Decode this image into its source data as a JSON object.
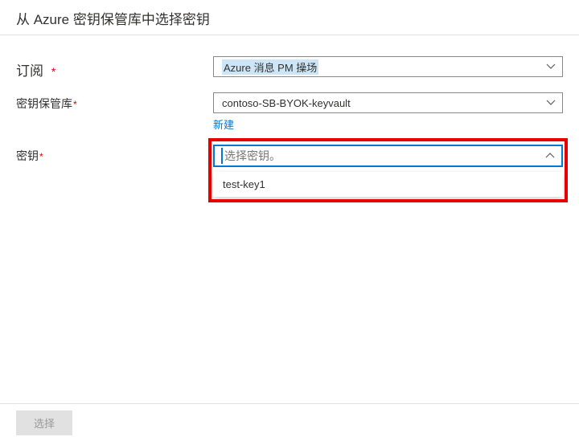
{
  "title": "从 Azure 密钥保管库中选择密钥",
  "fields": {
    "subscription": {
      "label": "订阅",
      "required_mark": "*",
      "value": "Azure 消息 PM 操场"
    },
    "keyvault": {
      "label": "密钥保管库",
      "required_mark": "*",
      "value": "contoso-SB-BYOK-keyvault",
      "create_new": "新建"
    },
    "key": {
      "label": "密钥",
      "required_mark": "*",
      "placeholder": "选择密钥。",
      "options": [
        "test-key1"
      ]
    }
  },
  "footer": {
    "select_label": "选择"
  }
}
